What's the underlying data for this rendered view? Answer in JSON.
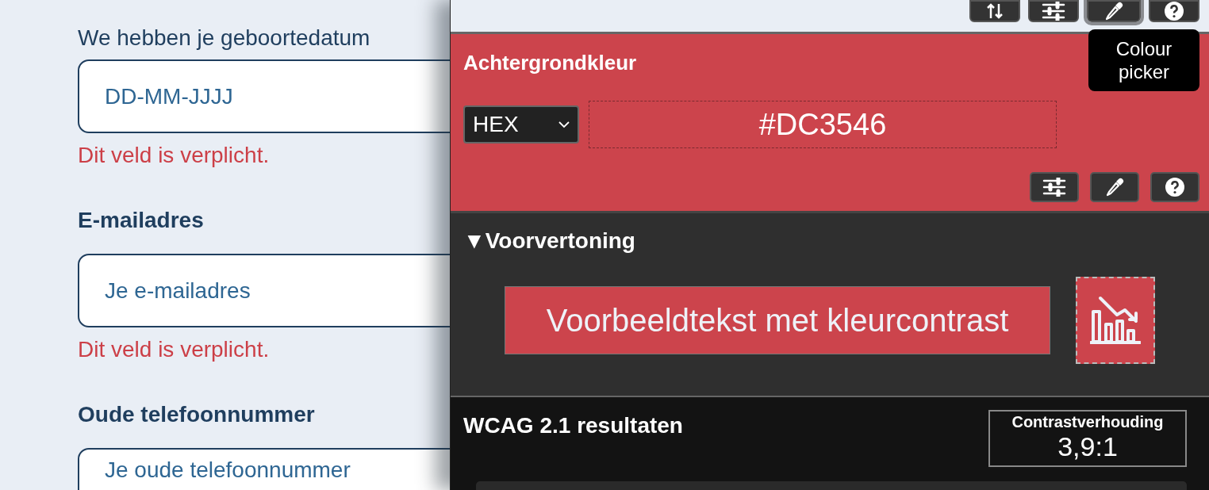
{
  "form": {
    "fields": [
      {
        "label": "We hebben je geboortedatum",
        "kind": "text",
        "placeholder": "DD-MM-JJJJ",
        "error": "Dit veld is verplicht."
      },
      {
        "label": "E-mailadres",
        "kind": "heading",
        "placeholder": "Je e-mailadres",
        "error": "Dit veld is verplicht."
      },
      {
        "label": "Oude telefoonnummer",
        "kind": "heading",
        "placeholder": "Je oude telefoonnummer"
      }
    ]
  },
  "panel": {
    "toolbar": [
      {
        "kind": "sort",
        "selected": false
      },
      {
        "kind": "sliders",
        "selected": false
      },
      {
        "kind": "eyedropper",
        "selected": true
      },
      {
        "kind": "help",
        "selected": false
      }
    ],
    "tooltip": "Colour\npicker",
    "background": {
      "title": "Achtergrondkleur",
      "format": "HEX",
      "value": "#DC3546",
      "tools": [
        {
          "kind": "sliders"
        },
        {
          "kind": "eyedropper"
        },
        {
          "kind": "help"
        }
      ]
    },
    "preview": {
      "toggle": "▼",
      "title": "Voorvertoning",
      "sample_text": "Voorbeeldtekst met kleurcontrast"
    },
    "wcag": {
      "title": "WCAG 2.1 resultaten",
      "ratio_label": "Contrastverhouding",
      "ratio": "3,9:1"
    }
  }
}
